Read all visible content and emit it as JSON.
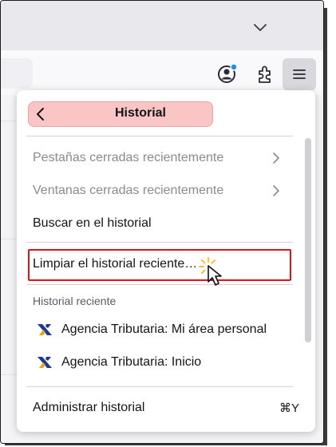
{
  "panel": {
    "title": "Historial",
    "items": [
      {
        "label": "Pestañas cerradas recientemente",
        "disabled": true,
        "submenu": true
      },
      {
        "label": "Ventanas cerradas recientemente",
        "disabled": true,
        "submenu": true
      },
      {
        "label": "Buscar en el historial",
        "disabled": false,
        "submenu": false
      },
      {
        "label": "Limpiar el historial reciente…",
        "disabled": false,
        "submenu": false
      }
    ],
    "recent_label": "Historial reciente",
    "recent": [
      {
        "label": "Agencia Tributaria: Mi área personal",
        "icon": "agencia-tributaria-icon"
      },
      {
        "label": "Agencia Tributaria: Inicio",
        "icon": "agencia-tributaria-icon"
      }
    ],
    "manage_label": "Administrar historial",
    "manage_shortcut": "⌘Y"
  },
  "toolbar": {
    "icons": [
      "account-icon",
      "extensions-icon",
      "hamburger-menu-icon"
    ]
  },
  "colors": {
    "highlight_border": "#e3101b",
    "header_bg": "#f9c5c5",
    "notification_dot": "#1f8ff5"
  }
}
